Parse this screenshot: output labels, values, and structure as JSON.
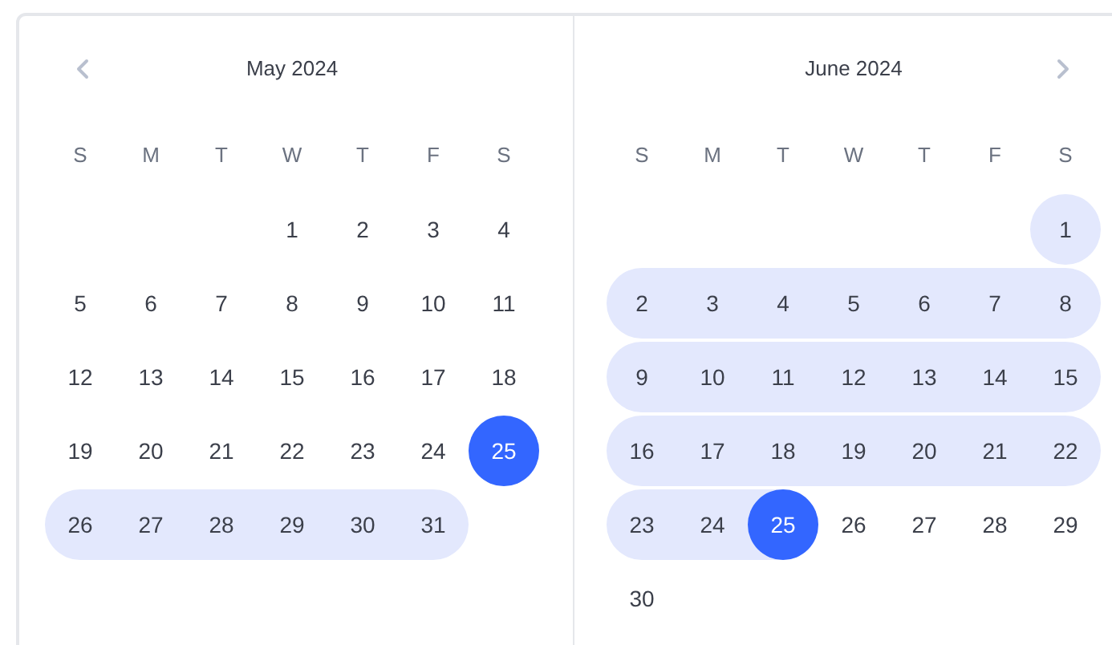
{
  "months": [
    {
      "title": "May 2024",
      "prev_button": true,
      "weekdays": [
        "S",
        "M",
        "T",
        "W",
        "T",
        "F",
        "S"
      ],
      "weeks": [
        {
          "right_aligned": true,
          "days": [
            {
              "label": "1",
              "selected": false,
              "in_range": false
            },
            {
              "label": "2",
              "selected": false,
              "in_range": false
            },
            {
              "label": "3",
              "selected": false,
              "in_range": false
            },
            {
              "label": "4",
              "selected": false,
              "in_range": false
            }
          ]
        },
        {
          "days": [
            {
              "label": "5",
              "selected": false,
              "in_range": false
            },
            {
              "label": "6",
              "selected": false,
              "in_range": false
            },
            {
              "label": "7",
              "selected": false,
              "in_range": false
            },
            {
              "label": "8",
              "selected": false,
              "in_range": false
            },
            {
              "label": "9",
              "selected": false,
              "in_range": false
            },
            {
              "label": "10",
              "selected": false,
              "in_range": false
            },
            {
              "label": "11",
              "selected": false,
              "in_range": false
            }
          ]
        },
        {
          "days": [
            {
              "label": "12",
              "selected": false,
              "in_range": false
            },
            {
              "label": "13",
              "selected": false,
              "in_range": false
            },
            {
              "label": "14",
              "selected": false,
              "in_range": false
            },
            {
              "label": "15",
              "selected": false,
              "in_range": false
            },
            {
              "label": "16",
              "selected": false,
              "in_range": false
            },
            {
              "label": "17",
              "selected": false,
              "in_range": false
            },
            {
              "label": "18",
              "selected": false,
              "in_range": false
            }
          ]
        },
        {
          "days": [
            {
              "label": "19",
              "selected": false,
              "in_range": false
            },
            {
              "label": "20",
              "selected": false,
              "in_range": false
            },
            {
              "label": "21",
              "selected": false,
              "in_range": false
            },
            {
              "label": "22",
              "selected": false,
              "in_range": false
            },
            {
              "label": "23",
              "selected": false,
              "in_range": false
            },
            {
              "label": "24",
              "selected": false,
              "in_range": false
            },
            {
              "label": "25",
              "selected": true,
              "in_range": true
            }
          ]
        },
        {
          "right_aligned": false,
          "days": [
            {
              "label": "26",
              "selected": false,
              "in_range": true
            },
            {
              "label": "27",
              "selected": false,
              "in_range": true
            },
            {
              "label": "28",
              "selected": false,
              "in_range": true
            },
            {
              "label": "29",
              "selected": false,
              "in_range": true
            },
            {
              "label": "30",
              "selected": false,
              "in_range": true
            },
            {
              "label": "31",
              "selected": false,
              "in_range": true
            }
          ]
        }
      ]
    },
    {
      "title": "June 2024",
      "next_button": true,
      "weekdays": [
        "S",
        "M",
        "T",
        "W",
        "T",
        "F",
        "S"
      ],
      "weeks": [
        {
          "right_aligned": true,
          "days": [
            {
              "label": "1",
              "selected": false,
              "in_range": true
            }
          ]
        },
        {
          "days": [
            {
              "label": "2",
              "selected": false,
              "in_range": true
            },
            {
              "label": "3",
              "selected": false,
              "in_range": true
            },
            {
              "label": "4",
              "selected": false,
              "in_range": true
            },
            {
              "label": "5",
              "selected": false,
              "in_range": true
            },
            {
              "label": "6",
              "selected": false,
              "in_range": true
            },
            {
              "label": "7",
              "selected": false,
              "in_range": true
            },
            {
              "label": "8",
              "selected": false,
              "in_range": true
            }
          ]
        },
        {
          "days": [
            {
              "label": "9",
              "selected": false,
              "in_range": true
            },
            {
              "label": "10",
              "selected": false,
              "in_range": true
            },
            {
              "label": "11",
              "selected": false,
              "in_range": true
            },
            {
              "label": "12",
              "selected": false,
              "in_range": true
            },
            {
              "label": "13",
              "selected": false,
              "in_range": true
            },
            {
              "label": "14",
              "selected": false,
              "in_range": true
            },
            {
              "label": "15",
              "selected": false,
              "in_range": true
            }
          ]
        },
        {
          "days": [
            {
              "label": "16",
              "selected": false,
              "in_range": true
            },
            {
              "label": "17",
              "selected": false,
              "in_range": true
            },
            {
              "label": "18",
              "selected": false,
              "in_range": true
            },
            {
              "label": "19",
              "selected": false,
              "in_range": true
            },
            {
              "label": "20",
              "selected": false,
              "in_range": true
            },
            {
              "label": "21",
              "selected": false,
              "in_range": true
            },
            {
              "label": "22",
              "selected": false,
              "in_range": true
            }
          ]
        },
        {
          "days": [
            {
              "label": "23",
              "selected": false,
              "in_range": true
            },
            {
              "label": "24",
              "selected": false,
              "in_range": true
            },
            {
              "label": "25",
              "selected": true,
              "in_range": true
            },
            {
              "label": "26",
              "selected": false,
              "in_range": false
            },
            {
              "label": "27",
              "selected": false,
              "in_range": false
            },
            {
              "label": "28",
              "selected": false,
              "in_range": false
            },
            {
              "label": "29",
              "selected": false,
              "in_range": false
            }
          ]
        },
        {
          "right_aligned": false,
          "days": [
            {
              "label": "30",
              "selected": false,
              "in_range": false
            }
          ]
        }
      ]
    }
  ]
}
